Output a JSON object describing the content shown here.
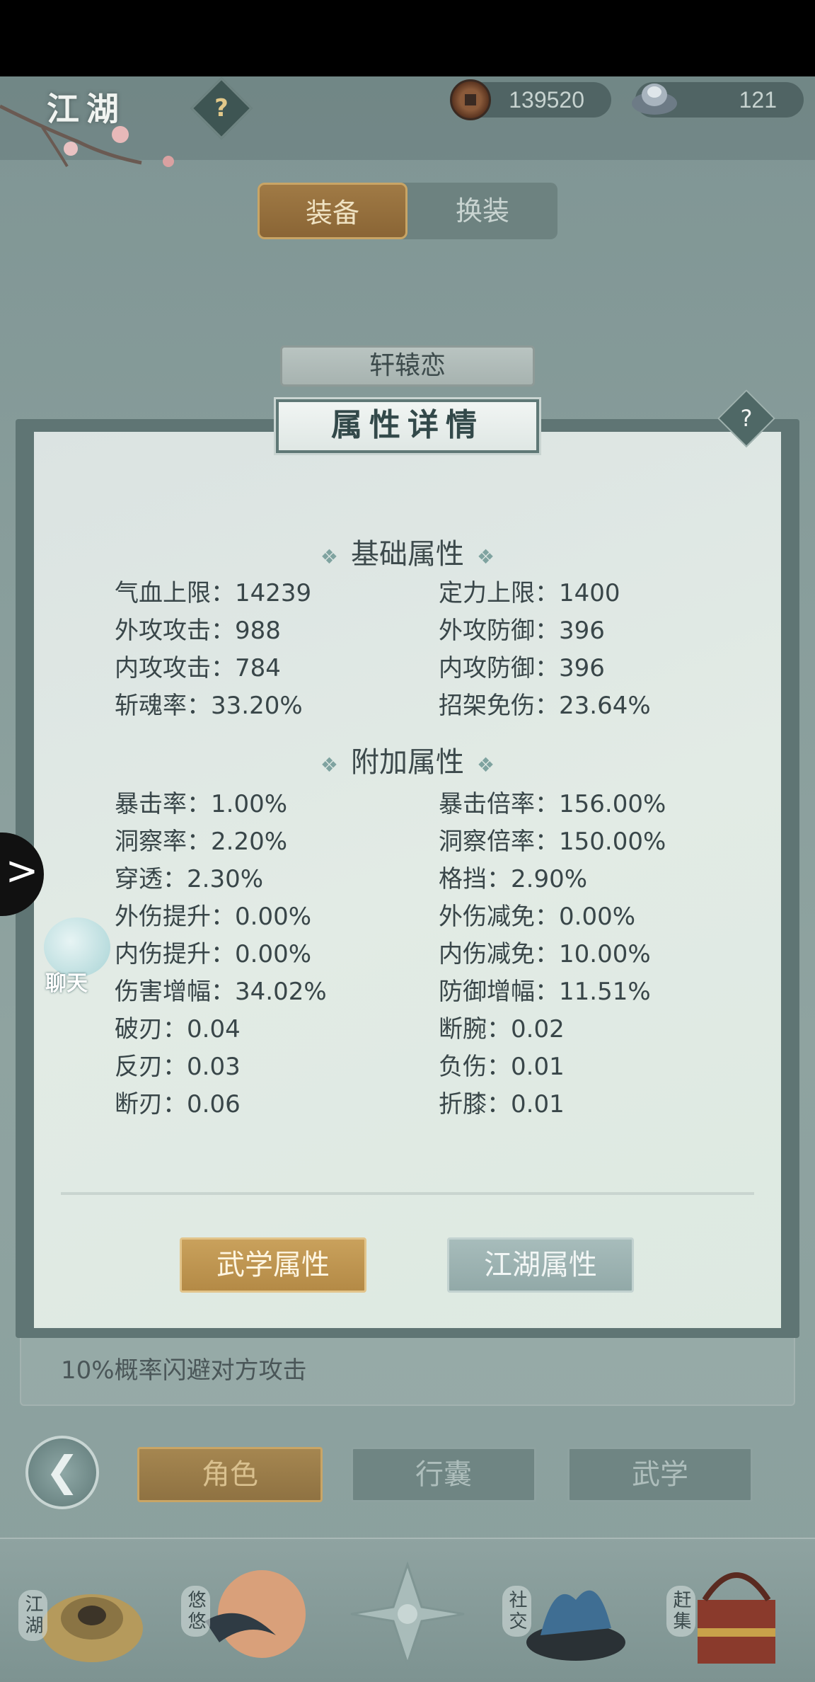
{
  "header": {
    "title": "江湖",
    "help_symbol": "?",
    "copper": "139520",
    "silver": "121"
  },
  "equip_tabs": [
    "装备",
    "换装"
  ],
  "character_name": "轩辕恋",
  "dialog": {
    "title": "属性详情",
    "help_symbol": "?",
    "base_section": "基础属性",
    "base_attrs": [
      [
        "气血上限：14239",
        "定力上限：1400"
      ],
      [
        "外攻攻击：988",
        "外攻防御：396"
      ],
      [
        "内攻攻击：784",
        "内攻防御：396"
      ],
      [
        "斩魂率：33.20%",
        "招架免伤：23.64%"
      ]
    ],
    "extra_section": "附加属性",
    "extra_attrs": [
      [
        "暴击率：1.00%",
        "暴击倍率：156.00%"
      ],
      [
        "洞察率：2.20%",
        "洞察倍率：150.00%"
      ],
      [
        "穿透：2.30%",
        "格挡：2.90%"
      ],
      [
        "外伤提升：0.00%",
        "外伤减免：0.00%"
      ],
      [
        "内伤提升：0.00%",
        "内伤减免：10.00%"
      ],
      [
        "伤害增幅：34.02%",
        "防御增幅：11.51%"
      ],
      [
        "破刃：0.04",
        "断腕：0.02"
      ],
      [
        "反刃：0.03",
        "负伤：0.01"
      ],
      [
        "断刃：0.06",
        "折膝：0.01"
      ]
    ],
    "btn_wuxue": "武学属性",
    "btn_jianghu": "江湖属性"
  },
  "description": "10%概率闪避对方攻击",
  "chat_label": "聊天",
  "side_arrow": ">",
  "back_symbol": "❮",
  "nav_tabs": [
    "角色",
    "行囊",
    "武学"
  ],
  "bottom_nav": [
    "江湖",
    "悠悠",
    "社交",
    "赶集"
  ],
  "colors": {
    "accent_gold": "#b48a46",
    "panel_teal": "#5f7574",
    "dialog_bg": "#e2ebe5"
  }
}
